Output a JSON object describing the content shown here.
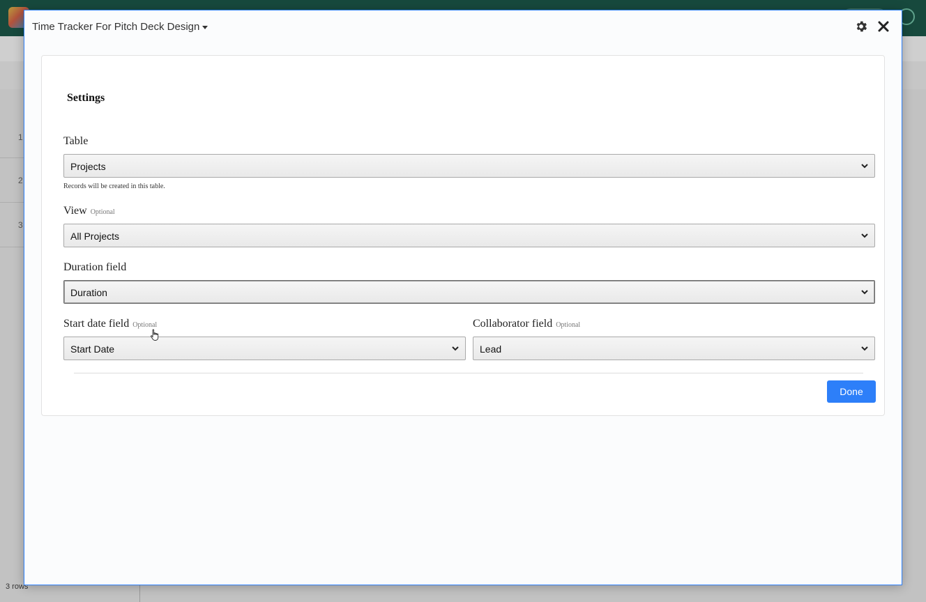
{
  "background": {
    "row_numbers": [
      "1",
      "2",
      "3"
    ],
    "footer_text": "3 rows"
  },
  "modal": {
    "title": "Time Tracker For Pitch Deck Design"
  },
  "settings": {
    "heading": "Settings",
    "table": {
      "label": "Table",
      "value": "Projects",
      "hint": "Records will be created in this table."
    },
    "view": {
      "label": "View",
      "optional": "Optional",
      "value": "All Projects"
    },
    "duration": {
      "label": "Duration field",
      "value": "Duration"
    },
    "start_date": {
      "label": "Start date field",
      "optional": "Optional",
      "value": "Start Date"
    },
    "collaborator": {
      "label": "Collaborator field",
      "optional": "Optional",
      "value": "Lead"
    },
    "done_label": "Done"
  },
  "colors": {
    "accent": "#2d7ff9",
    "topbar": "#17493d"
  }
}
